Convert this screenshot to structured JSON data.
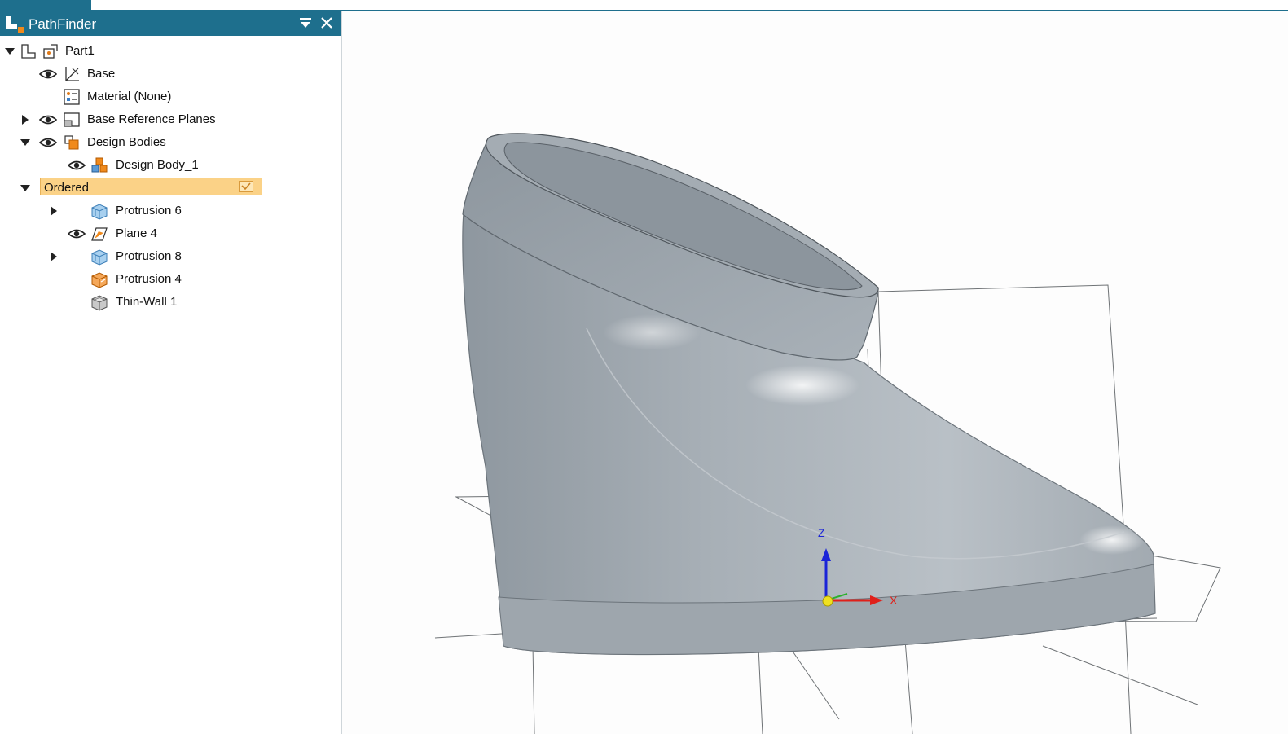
{
  "window_tab": {
    "label": ""
  },
  "pathfinder": {
    "title": "PathFinder",
    "collapse_icon": "dropdown-collapse-icon",
    "close_icon": "close-icon"
  },
  "tree": {
    "root": {
      "label": "Part1"
    },
    "items": [
      {
        "label": "Base",
        "icon": "coordinate-system-icon"
      },
      {
        "label": "Material (None)",
        "icon": "material-icon"
      },
      {
        "label": "Base Reference Planes",
        "icon": "reference-planes-icon"
      },
      {
        "label": "Design Bodies",
        "icon": "design-bodies-icon"
      },
      {
        "label": "Design Body_1",
        "icon": "design-body-icon"
      },
      {
        "label": "Ordered",
        "icon": "ordered-node"
      },
      {
        "label": "Protrusion 6",
        "icon": "protrusion-icon"
      },
      {
        "label": "Plane 4",
        "icon": "plane-icon"
      },
      {
        "label": "Protrusion 8",
        "icon": "protrusion-icon"
      },
      {
        "label": "Protrusion 4",
        "icon": "protrusion-orange-icon"
      },
      {
        "label": "Thin-Wall 1",
        "icon": "thin-wall-icon"
      }
    ]
  },
  "viewport": {
    "axis_z": "Z",
    "axis_x": "X",
    "colors": {
      "body": "#9aa3ab",
      "axis_x": "#e0201a",
      "axis_z": "#1a24d8",
      "origin": "#f0e020"
    }
  },
  "colors": {
    "header": "#1e6f8d",
    "selection": "#fbd287"
  }
}
